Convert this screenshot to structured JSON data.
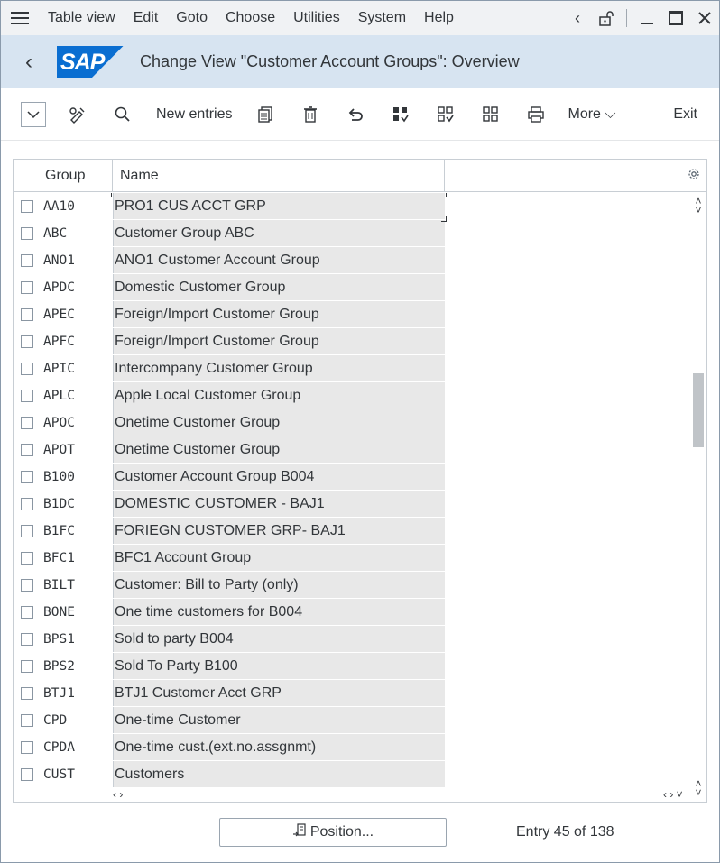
{
  "menubar": {
    "items": [
      "Table view",
      "Edit",
      "Goto",
      "Choose",
      "Utilities",
      "System",
      "Help"
    ]
  },
  "titlebar": {
    "logo_text": "SAP",
    "title": "Change View \"Customer Account Groups\": Overview"
  },
  "toolbar": {
    "new_entries": "New entries",
    "more": "More",
    "exit": "Exit"
  },
  "table": {
    "columns": [
      "Group",
      "Name"
    ],
    "rows": [
      {
        "group": "AA10",
        "name": "PRO1 CUS ACCT GRP"
      },
      {
        "group": "ABC",
        "name": "Customer Group ABC"
      },
      {
        "group": "ANO1",
        "name": "ANO1 Customer Account Group"
      },
      {
        "group": "APDC",
        "name": "Domestic Customer Group"
      },
      {
        "group": "APEC",
        "name": "Foreign/Import Customer Group"
      },
      {
        "group": "APFC",
        "name": "Foreign/Import Customer Group"
      },
      {
        "group": "APIC",
        "name": "Intercompany Customer Group"
      },
      {
        "group": "APLC",
        "name": "Apple Local Customer Group"
      },
      {
        "group": "APOC",
        "name": "Onetime Customer Group"
      },
      {
        "group": "APOT",
        "name": "Onetime Customer Group"
      },
      {
        "group": "B100",
        "name": "Customer Account Group B004"
      },
      {
        "group": "B1DC",
        "name": "DOMESTIC CUSTOMER - BAJ1"
      },
      {
        "group": "B1FC",
        "name": "FORIEGN CUSTOMER GRP- BAJ1"
      },
      {
        "group": "BFC1",
        "name": "BFC1 Account Group"
      },
      {
        "group": "BILT",
        "name": "Customer: Bill to Party (only)"
      },
      {
        "group": "BONE",
        "name": "One time customers for B004"
      },
      {
        "group": "BPS1",
        "name": "Sold to party B004"
      },
      {
        "group": "BPS2",
        "name": "Sold To Party B100"
      },
      {
        "group": "BTJ1",
        "name": "BTJ1 Customer Acct GRP"
      },
      {
        "group": "CPD",
        "name": "One-time Customer"
      },
      {
        "group": "CPDA",
        "name": "One-time cust.(ext.no.assgnmt)"
      },
      {
        "group": "CUST",
        "name": "Customers"
      }
    ]
  },
  "footer": {
    "position_button": "Position...",
    "entry_info": "Entry 45 of 138"
  }
}
